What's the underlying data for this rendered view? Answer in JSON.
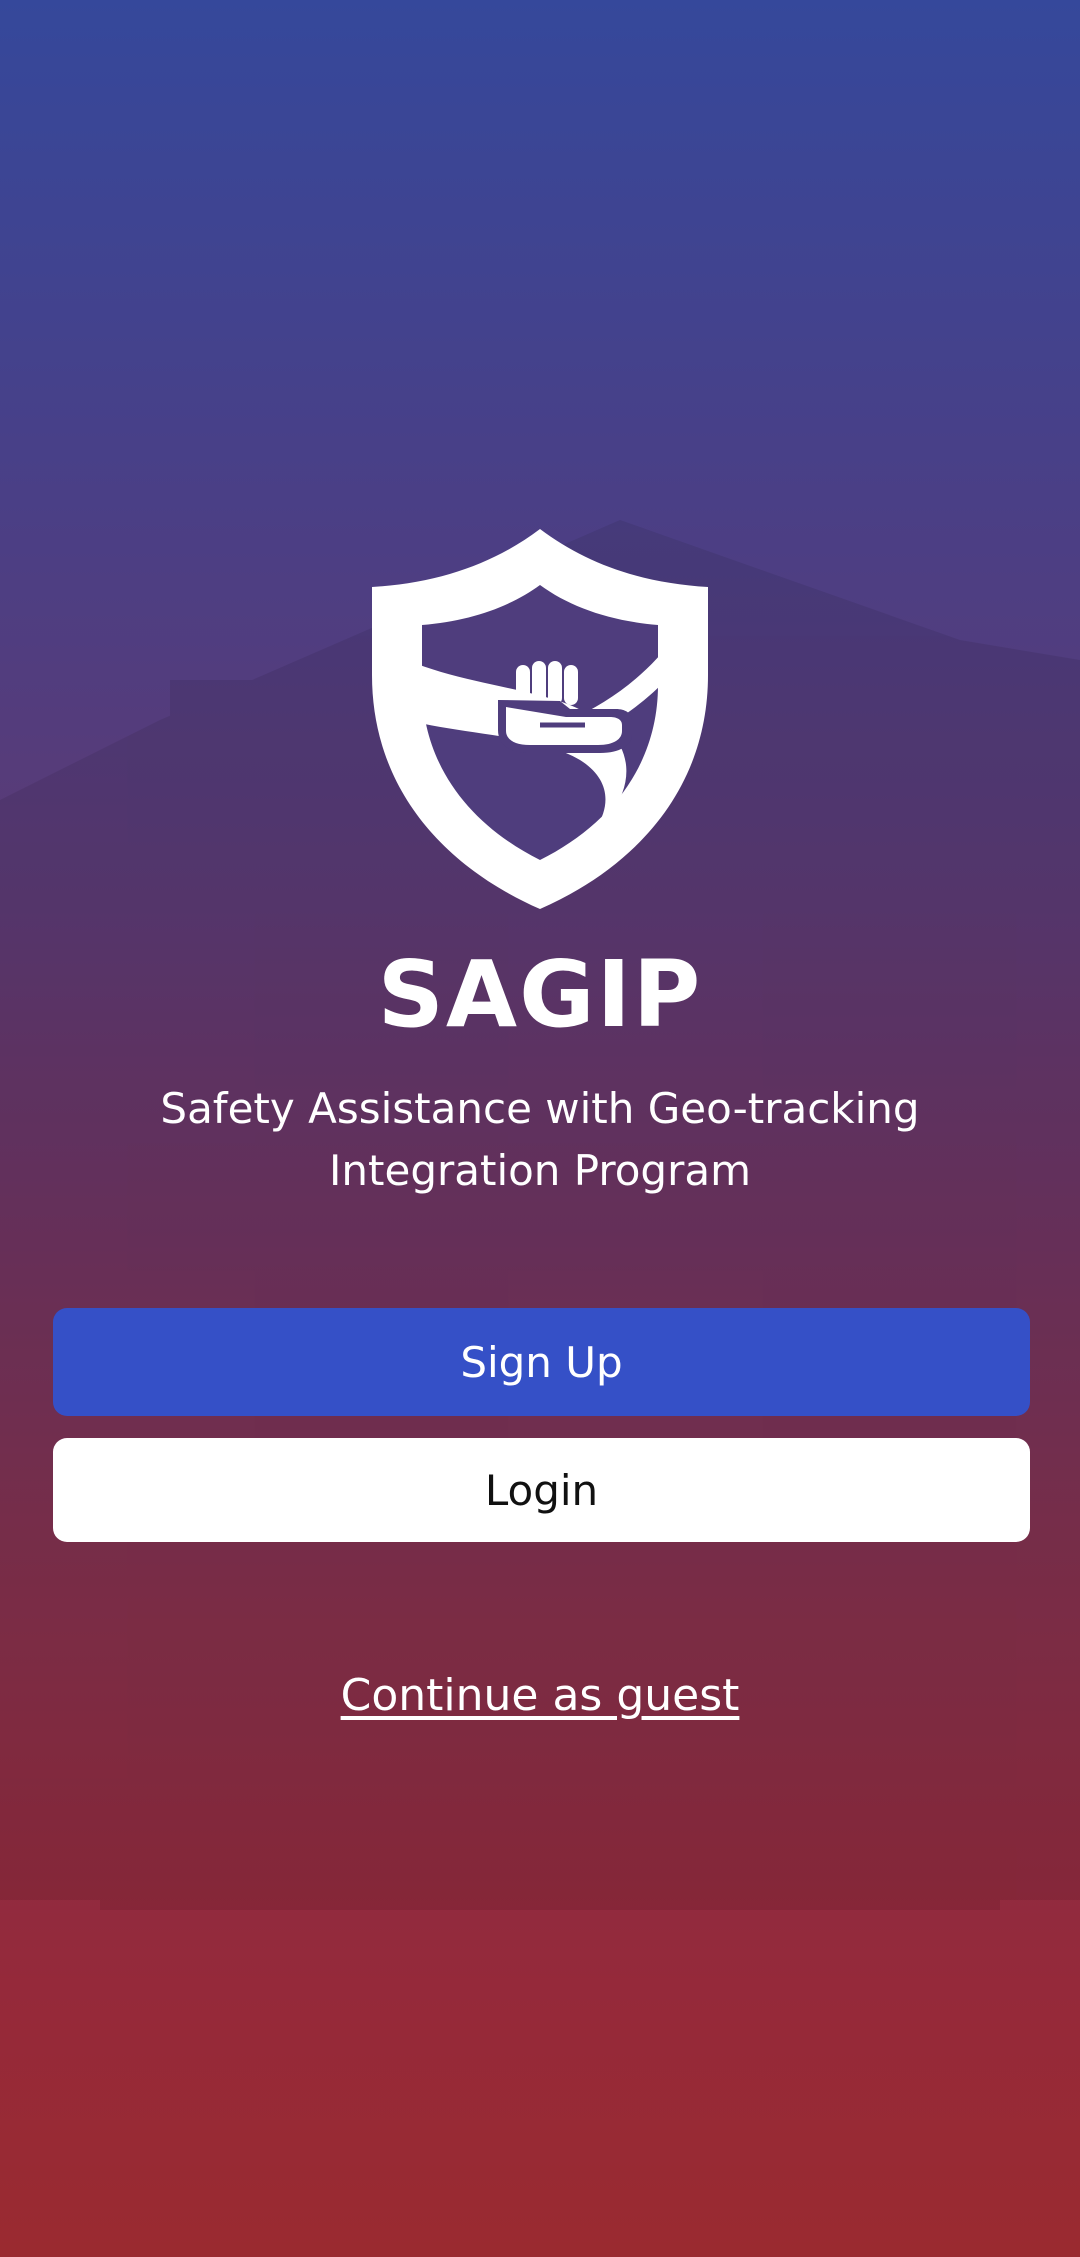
{
  "app": {
    "title": "SAGIP",
    "subtitle": "Safety Assistance with Geo-tracking Integration Program",
    "logo_icon": "shield-helping-hand-icon"
  },
  "actions": {
    "signup_label": "Sign Up",
    "login_label": "Login",
    "guest_label": "Continue as guest"
  },
  "colors": {
    "gradient_top": "#35489b",
    "gradient_bottom": "#9a2a30",
    "primary_button": "#3550c7",
    "secondary_button": "#ffffff",
    "text_on_dark": "#ffffff"
  }
}
